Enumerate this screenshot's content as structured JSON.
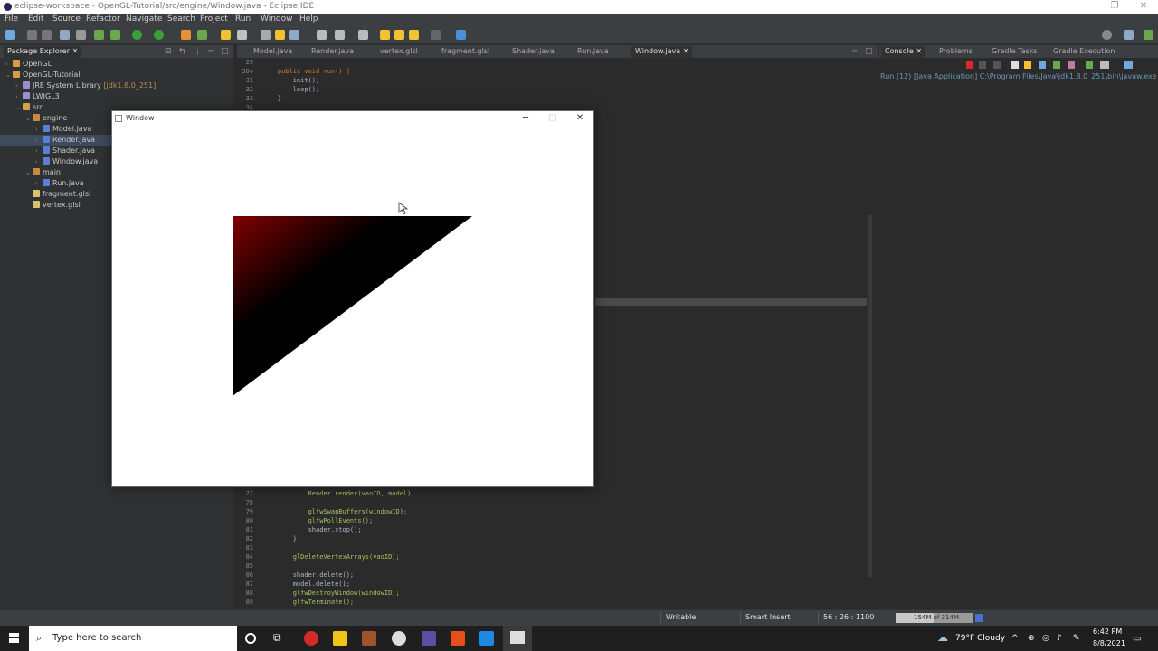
{
  "window": {
    "title": "eclipse-workspace - OpenGL-Tutorial/src/engine/Window.java - Eclipse IDE",
    "controls": [
      "─",
      "❐",
      "✕"
    ]
  },
  "menu": [
    "File",
    "Edit",
    "Source",
    "Refactor",
    "Navigate",
    "Search",
    "Project",
    "Run",
    "Window",
    "Help"
  ],
  "package_explorer": {
    "tab_label": "Package Explorer",
    "tree": [
      {
        "label": "OpenGL",
        "depth": 0,
        "arrow": "›",
        "icon": "project-icon"
      },
      {
        "label": "OpenGL-Tutorial",
        "depth": 0,
        "arrow": "⌄",
        "icon": "project-icon"
      },
      {
        "label": "JRE System Library",
        "extra": "[jdk1.8.0_251]",
        "depth": 1,
        "arrow": "›",
        "icon": "library-icon"
      },
      {
        "label": "LWJGL3",
        "depth": 1,
        "arrow": "›",
        "icon": "library-icon"
      },
      {
        "label": "src",
        "depth": 1,
        "arrow": "⌄",
        "icon": "folder-icon"
      },
      {
        "label": "engine",
        "depth": 2,
        "arrow": "⌄",
        "icon": "package-icon"
      },
      {
        "label": "Model.java",
        "depth": 3,
        "arrow": "›",
        "icon": "java-file-icon"
      },
      {
        "label": "Render.java",
        "depth": 3,
        "arrow": "›",
        "icon": "java-file-icon",
        "selected": true
      },
      {
        "label": "Shader.java",
        "depth": 3,
        "arrow": "›",
        "icon": "java-file-icon"
      },
      {
        "label": "Window.java",
        "depth": 3,
        "arrow": "›",
        "icon": "java-file-icon"
      },
      {
        "label": "main",
        "depth": 2,
        "arrow": "⌄",
        "icon": "package-icon"
      },
      {
        "label": "Run.java",
        "depth": 3,
        "arrow": "›",
        "icon": "java-file-icon"
      },
      {
        "label": "fragment.glsl",
        "depth": 2,
        "arrow": "",
        "icon": "file-icon"
      },
      {
        "label": "vertex.glsl",
        "depth": 2,
        "arrow": "",
        "icon": "file-icon"
      }
    ]
  },
  "editor": {
    "tabs": [
      "Model.java",
      "Render.java",
      "vertex.glsl",
      "fragment.glsl",
      "Shader.java",
      "Run.java",
      "Window.java"
    ],
    "active_tab": "Window.java",
    "top_lines": [
      {
        "n": "29",
        "code": ""
      },
      {
        "n": "30⊖",
        "code": "    public void run() {"
      },
      {
        "n": "31",
        "code": "        init();"
      },
      {
        "n": "32",
        "code": "        loop();"
      },
      {
        "n": "33",
        "code": "    }"
      },
      {
        "n": "34",
        "code": ""
      }
    ],
    "bottom_lines": [
      {
        "n": "77",
        "code": "            Render.render(vaoID, model);"
      },
      {
        "n": "78",
        "code": ""
      },
      {
        "n": "79",
        "code": "            glfwSwapBuffers(windowID);"
      },
      {
        "n": "80",
        "code": "            glfwPollEvents();"
      },
      {
        "n": "81",
        "code": "            shader.stop();"
      },
      {
        "n": "82",
        "code": "        }"
      },
      {
        "n": "83",
        "code": ""
      },
      {
        "n": "84",
        "code": "        glDeleteVertexArrays(vaoID);"
      },
      {
        "n": "85",
        "code": ""
      },
      {
        "n": "86",
        "code": "        shader.delete();"
      },
      {
        "n": "87",
        "code": "        model.delete();"
      },
      {
        "n": "88",
        "code": "        glfwDestroyWindow(windowID);"
      },
      {
        "n": "89",
        "code": "        glfwTerminate();"
      }
    ]
  },
  "console": {
    "tabs": [
      "Console",
      "Problems",
      "Gradle Tasks",
      "Gradle Execution"
    ],
    "run_line": "Run (12) [Java Application] C:\\Program Files\\Java\\jdk1.8.0_251\\bin\\javaw.exe  (Aug"
  },
  "status": {
    "writable": "Writable",
    "insert_mode": "Smart Insert",
    "position": "56 : 26 : 1100",
    "memory": "154M of 314M"
  },
  "gl_window": {
    "title": "Window",
    "controls": [
      "─",
      "□",
      "✕"
    ],
    "triangle_colors": {
      "corner": "#800000",
      "fill": "#000000"
    }
  },
  "taskbar": {
    "search_placeholder": "Type here to search",
    "weather": "79°F  Cloudy",
    "time": "6:42 PM",
    "date": "8/8/2021"
  },
  "colors": {
    "accent": "#3d4b5c",
    "panel_bg": "#3c3f41",
    "editor_bg": "#2b2b2b"
  }
}
